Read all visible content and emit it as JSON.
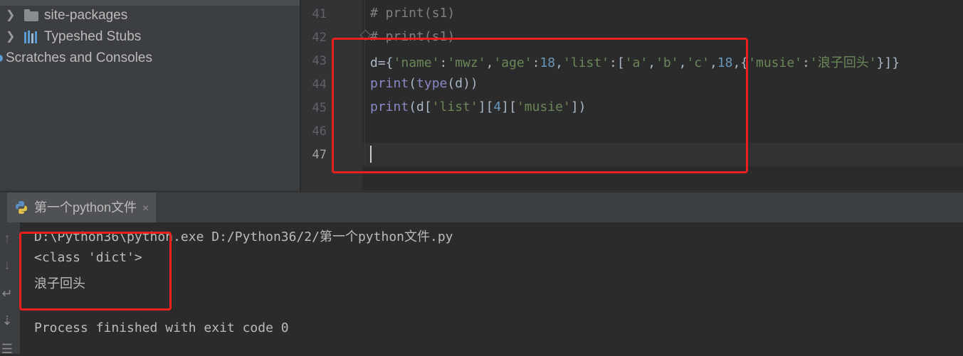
{
  "project_tree": {
    "items": [
      {
        "label": "site-packages",
        "icon": "folder-icon"
      },
      {
        "label": "Typeshed Stubs",
        "icon": "library-icon"
      },
      {
        "label": "Scratches and Consoles",
        "icon": "scratches-icon"
      }
    ]
  },
  "editor": {
    "line_numbers": [
      "41",
      "42",
      "43",
      "44",
      "45",
      "46",
      "47"
    ],
    "code": {
      "l41": "# print(s1)",
      "l42": "# print(s1)",
      "l43": {
        "a": "d={",
        "s1": "'name'",
        "b": ":",
        "s2": "'mwz'",
        "c": ",",
        "s3": "'age'",
        "d": ":",
        "n1": "18",
        "e": ",",
        "s4": "'list'",
        "f": ":[",
        "s5": "'a'",
        "g": ",",
        "s6": "'b'",
        "h": ",",
        "s7": "'c'",
        "i": ",",
        "n2": "18",
        "j": ",{",
        "s8": "'musie'",
        "k": ":",
        "q1": "'",
        "cjk": "浪子回头",
        "q2": "'",
        "end": "}]}"
      },
      "l44": {
        "fn": "print",
        "p1": "(",
        "fn2": "type",
        "rest": "(d))"
      },
      "l45": {
        "fn": "print",
        "a": "(d[",
        "s1": "'list'",
        "b": "][",
        "n": "4",
        "c": "][",
        "s2": "'musie'",
        "d": "])"
      }
    }
  },
  "run": {
    "tab_title": "第一个python文件",
    "tab_close": "×",
    "output": [
      "D:\\Python36\\python.exe D:/Python36/2/第一个python文件.py",
      "<class 'dict'>",
      "浪子回头",
      "",
      "Process finished with exit code 0"
    ]
  },
  "colors": {
    "highlight_box": "#e8201e"
  }
}
